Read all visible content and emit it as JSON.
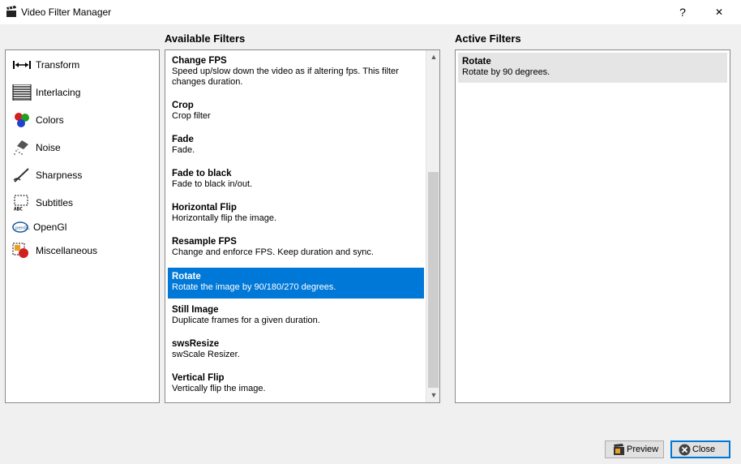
{
  "window": {
    "title": "Video Filter Manager",
    "help_label": "?",
    "close_label": "✕"
  },
  "headings": {
    "available": "Available Filters",
    "active": "Active Filters"
  },
  "categories": [
    {
      "label": "Transform",
      "icon": "transform-icon"
    },
    {
      "label": "Interlacing",
      "icon": "interlacing-icon"
    },
    {
      "label": "Colors",
      "icon": "colors-icon"
    },
    {
      "label": "Noise",
      "icon": "noise-icon"
    },
    {
      "label": "Sharpness",
      "icon": "sharpness-icon"
    },
    {
      "label": "Subtitles",
      "icon": "subtitles-icon"
    },
    {
      "label": "OpenGl",
      "icon": "opengl-icon"
    },
    {
      "label": "Miscellaneous",
      "icon": "miscellaneous-icon"
    }
  ],
  "available_filters": [
    {
      "name": "Change FPS",
      "desc": "Speed up/slow down the video as if altering fps. This filter changes duration."
    },
    {
      "name": "Crop",
      "desc": "Crop filter"
    },
    {
      "name": "Fade",
      "desc": "Fade."
    },
    {
      "name": "Fade to black",
      "desc": "Fade to black in/out."
    },
    {
      "name": "Horizontal Flip",
      "desc": "Horizontally flip the image."
    },
    {
      "name": "Resample FPS",
      "desc": "Change and enforce FPS. Keep duration and sync."
    },
    {
      "name": "Rotate",
      "desc": "Rotate the image by 90/180/270 degrees.",
      "selected": true
    },
    {
      "name": "Still Image",
      "desc": "Duplicate frames for a given duration."
    },
    {
      "name": "swsResize",
      "desc": "swScale Resizer."
    },
    {
      "name": "Vertical Flip",
      "desc": "Vertically flip the image."
    }
  ],
  "active_filters": [
    {
      "name": "Rotate",
      "desc": "Rotate by 90 degrees."
    }
  ],
  "buttons": {
    "preview": "Preview",
    "close": "Close"
  },
  "scrollbar": {
    "up": "▲",
    "down": "▼"
  },
  "colors": {
    "selection": "#0078d7",
    "active_item_bg": "#e5e5e5"
  }
}
